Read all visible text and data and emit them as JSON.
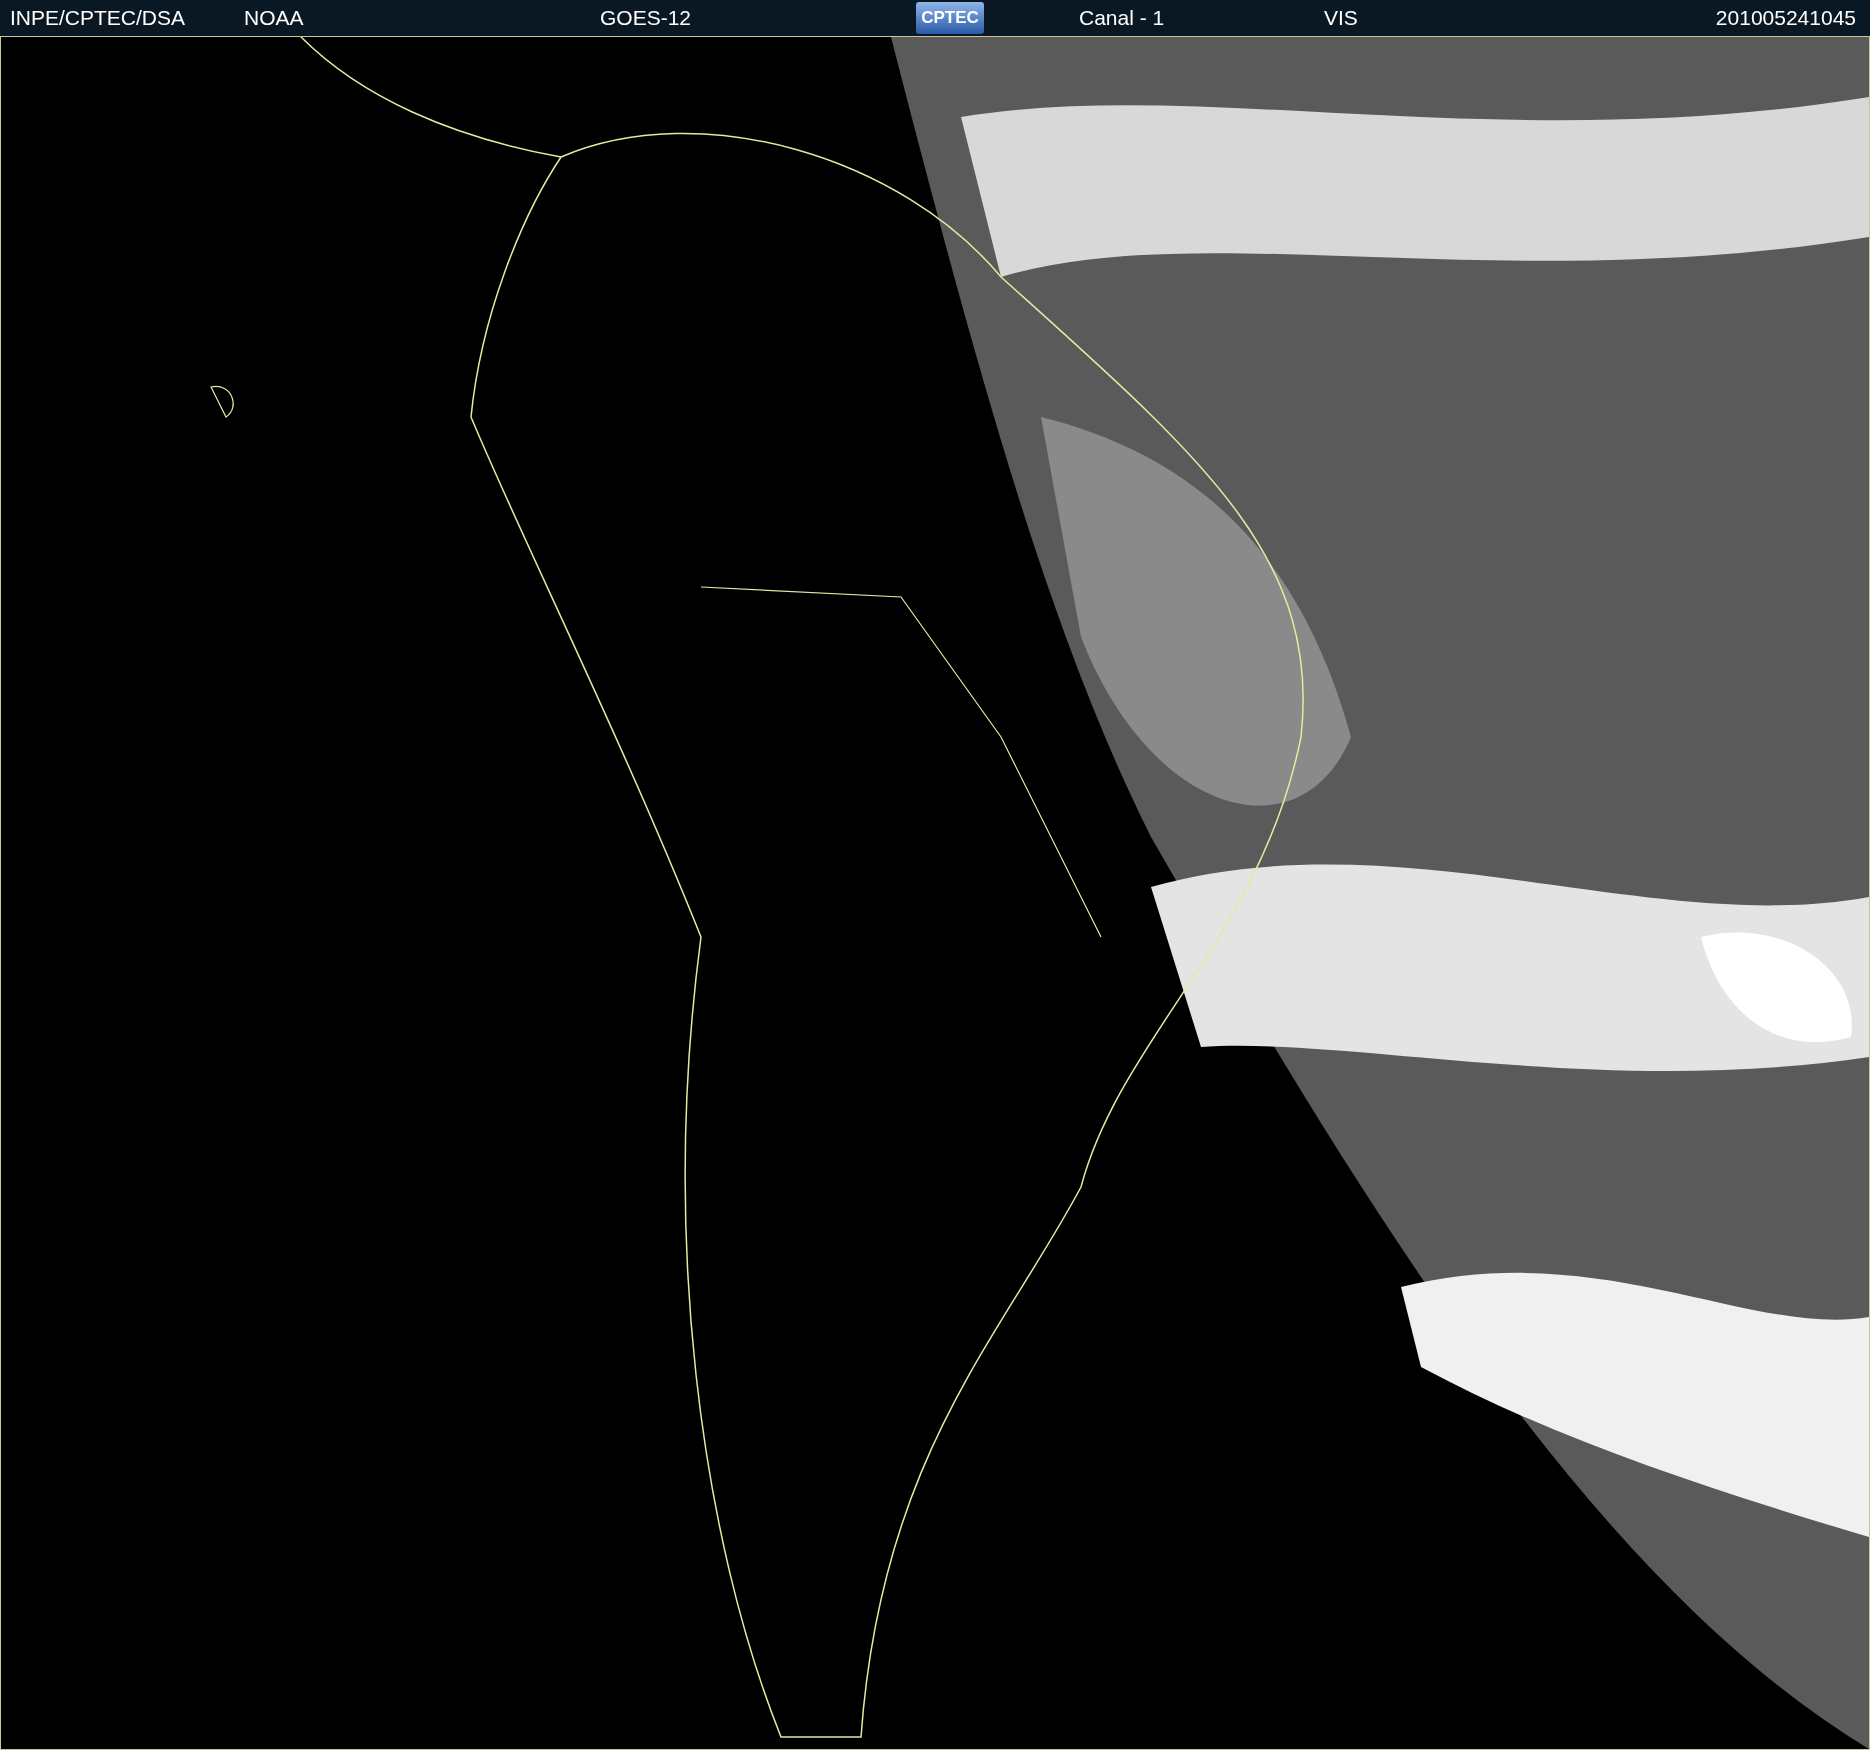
{
  "header": {
    "source": "INPE/CPTEC/DSA",
    "agency": "NOAA",
    "satellite": "GOES-12",
    "logo": "CPTEC",
    "channel": "Canal - 1",
    "band": "VIS",
    "timestamp": "201005241045"
  }
}
